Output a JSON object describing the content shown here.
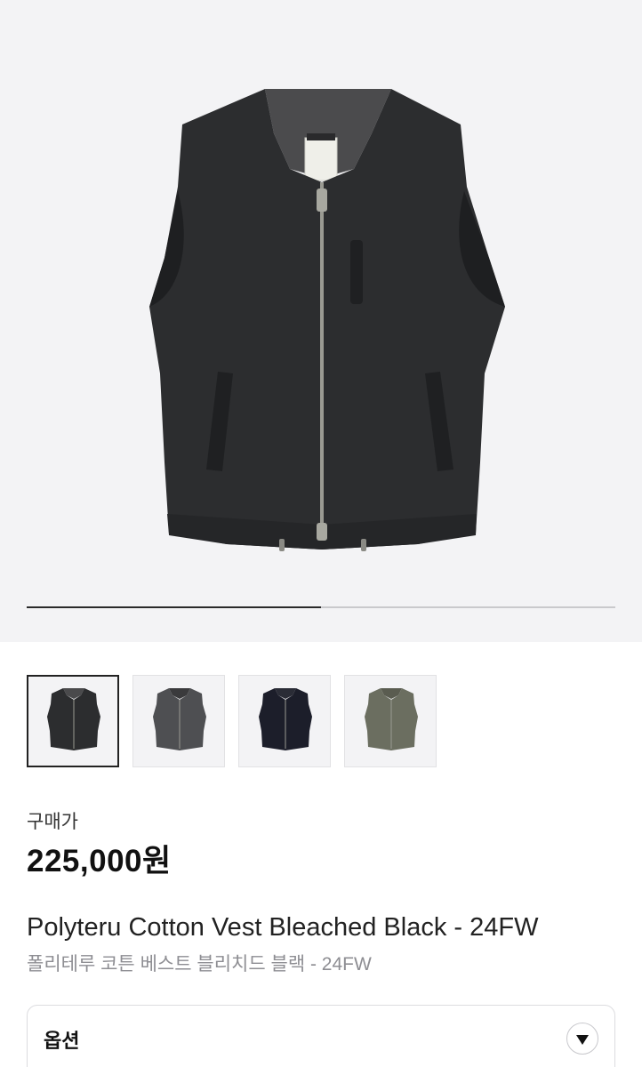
{
  "gallery": {
    "progress_fraction": 0.5,
    "thumbnails": [
      {
        "color_name": "bleached-black",
        "body_color": "#2c2d2f",
        "lining_color": "#4a4a4c",
        "selected": true
      },
      {
        "color_name": "charcoal",
        "body_color": "#4e4f52",
        "lining_color": "#3a3a3c",
        "selected": false
      },
      {
        "color_name": "navy",
        "body_color": "#1c1e2a",
        "lining_color": "#2a2c36",
        "selected": false
      },
      {
        "color_name": "olive",
        "body_color": "#6b6e60",
        "lining_color": "#5a5c50",
        "selected": false
      }
    ]
  },
  "product": {
    "price_label": "구매가",
    "price": "225,000원",
    "name_en": "Polyteru Cotton Vest Bleached Black - 24FW",
    "name_ko": "폴리테루 코튼 베스트 블리치드 블랙 - 24FW"
  },
  "options": {
    "label": "옵션",
    "toggle_icon": "chevron-down-icon"
  },
  "colors": {
    "background": "#f3f3f5",
    "vest_main": "#2c2d2f",
    "zipper": "#9a9a92"
  }
}
